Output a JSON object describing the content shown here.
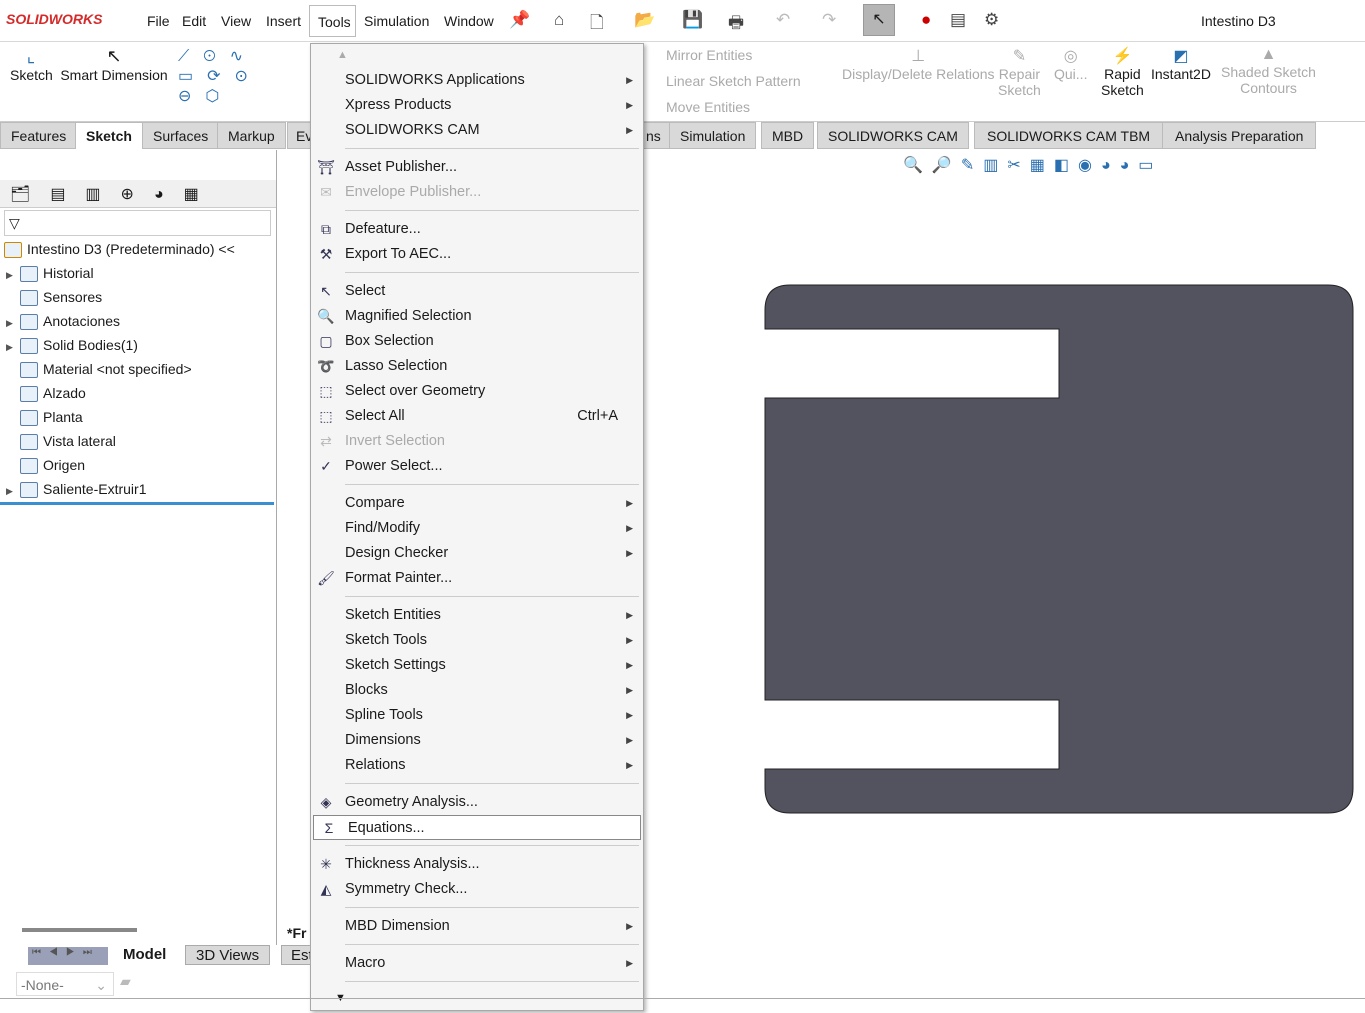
{
  "app": {
    "logo": "SOLIDWORKS",
    "document_title": "Intestino D3"
  },
  "menubar": [
    "File",
    "Edit",
    "View",
    "Insert",
    "Tools",
    "Simulation",
    "Window"
  ],
  "ribbon": {
    "sketch": "Sketch",
    "smart_dimension": "Smart Dimension",
    "mirror": "Mirror Entities",
    "linear_pattern": "Linear Sketch Pattern",
    "move": "Move Entities",
    "display_relations": "Display/Delete Relations",
    "repair1": "Repair",
    "repair2": "Sketch",
    "quick": "Qui...",
    "rapid1": "Rapid",
    "rapid2": "Sketch",
    "instant2d": "Instant2D",
    "shaded1": "Shaded Sketch",
    "shaded2": "Contours"
  },
  "tabs_left": [
    "Features",
    "Sketch",
    "Surfaces",
    "Markup",
    "Ev"
  ],
  "tabs_right": [
    "ns",
    "Simulation",
    "MBD",
    "SOLIDWORKS CAM",
    "SOLIDWORKS CAM TBM",
    "Analysis Preparation"
  ],
  "tree": {
    "root": "Intestino D3 (Predeterminado) <<",
    "items": [
      {
        "label": "Historial",
        "expand": true
      },
      {
        "label": "Sensores",
        "expand": false
      },
      {
        "label": "Anotaciones",
        "expand": true
      },
      {
        "label": "Solid Bodies(1)",
        "expand": true
      },
      {
        "label": "Material <not specified>",
        "expand": false
      },
      {
        "label": "Alzado",
        "expand": false
      },
      {
        "label": "Planta",
        "expand": false
      },
      {
        "label": "Vista lateral",
        "expand": false
      },
      {
        "label": "Origen",
        "expand": false
      },
      {
        "label": "Saliente-Extruir1",
        "expand": true
      }
    ]
  },
  "menu": [
    {
      "label": "SOLIDWORKS Applications",
      "sub": true
    },
    {
      "label": "Xpress Products",
      "sub": true
    },
    {
      "label": "SOLIDWORKS CAM",
      "sub": true
    },
    {
      "sep": true
    },
    {
      "label": "Asset Publisher...",
      "icon": "asset-publisher"
    },
    {
      "label": "Envelope Publisher...",
      "disabled": true,
      "icon": "envelope-publisher"
    },
    {
      "sep": true
    },
    {
      "label": "Defeature...",
      "icon": "defeature"
    },
    {
      "label": "Export To AEC...",
      "icon": "export-aec"
    },
    {
      "sep": true
    },
    {
      "label": "Select",
      "icon": "select-arrow"
    },
    {
      "label": "Magnified Selection",
      "icon": "magnifier"
    },
    {
      "label": "Box Selection",
      "icon": "box-select"
    },
    {
      "label": "Lasso Selection",
      "icon": "lasso"
    },
    {
      "label": "Select over Geometry",
      "icon": "select-geometry"
    },
    {
      "label": "Select All",
      "shortcut": "Ctrl+A",
      "icon": "select-all"
    },
    {
      "label": "Invert Selection",
      "disabled": true,
      "icon": "invert-selection"
    },
    {
      "label": "Power Select...",
      "icon": "power-select"
    },
    {
      "sep": true
    },
    {
      "label": "Compare",
      "sub": true
    },
    {
      "label": "Find/Modify",
      "sub": true
    },
    {
      "label": "Design Checker",
      "sub": true
    },
    {
      "label": "Format Painter...",
      "icon": "format-painter"
    },
    {
      "sep": true
    },
    {
      "label": "Sketch Entities",
      "sub": true
    },
    {
      "label": "Sketch Tools",
      "sub": true
    },
    {
      "label": "Sketch Settings",
      "sub": true
    },
    {
      "label": "Blocks",
      "sub": true
    },
    {
      "label": "Spline Tools",
      "sub": true
    },
    {
      "label": "Dimensions",
      "sub": true
    },
    {
      "label": "Relations",
      "sub": true
    },
    {
      "sep": true
    },
    {
      "label": "Geometry Analysis...",
      "icon": "geometry-analysis"
    },
    {
      "label": "Equations...",
      "icon": "sigma",
      "highlighted": true
    },
    {
      "sep": true
    },
    {
      "label": "Thickness Analysis...",
      "icon": "thickness"
    },
    {
      "label": "Symmetry Check...",
      "icon": "symmetry"
    },
    {
      "sep": true
    },
    {
      "label": "MBD Dimension",
      "sub": true
    },
    {
      "sep": true
    },
    {
      "label": "Macro",
      "sub": true
    },
    {
      "sep": true
    }
  ],
  "bottom": {
    "tabs": [
      "Model",
      "3D Views",
      "Est"
    ],
    "frag": "*Fr",
    "config": "-None-"
  },
  "colors": {
    "part": "#52535e",
    "accent": "#d42a2a"
  }
}
